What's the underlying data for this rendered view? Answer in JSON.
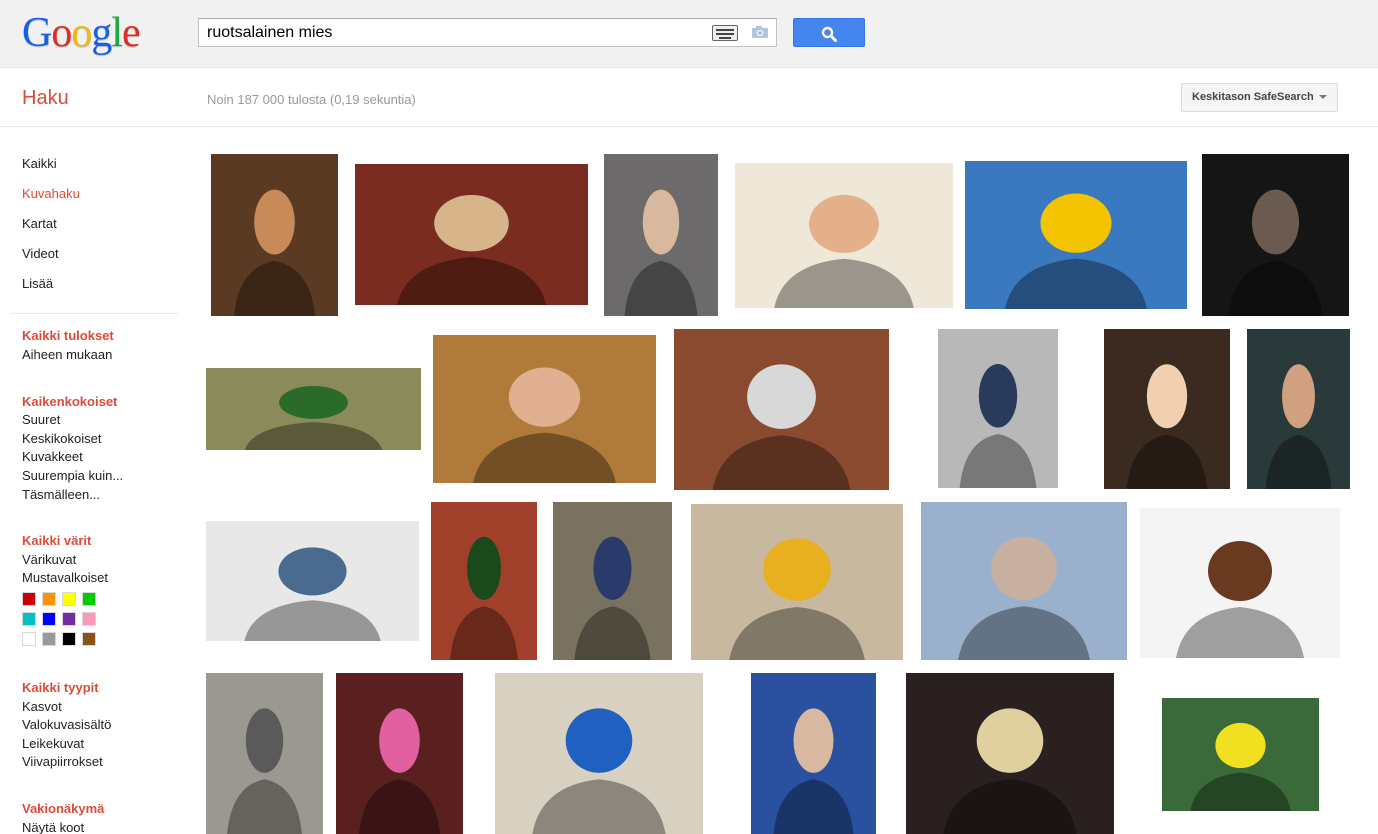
{
  "logo": {
    "letters": [
      "G",
      "o",
      "o",
      "g",
      "l",
      "e"
    ],
    "colors": [
      "#1a5ee8",
      "#dd2f23",
      "#f2b90a",
      "#1a5ee8",
      "#1ba83d",
      "#dd2f23"
    ]
  },
  "search": {
    "query": "ruotsalainen mies"
  },
  "subheader": {
    "title": "Haku",
    "stats": "Noin 187 000 tulosta (0,19 sekuntia)",
    "safesearch": "Keskitason SafeSearch"
  },
  "nav": {
    "primary": [
      "Kaikki",
      "Kuvahaku",
      "Kartat",
      "Videot",
      "Lisää"
    ],
    "results_head": "Kaikki tulokset",
    "results_items": [
      "Aiheen mukaan"
    ],
    "size_head": "Kaikenkokoiset",
    "size_items": [
      "Suuret",
      "Keskikokoiset",
      "Kuvakkeet",
      "Suurempia kuin...",
      "Täsmälleen..."
    ],
    "color_head": "Kaikki värit",
    "color_items": [
      "Värikuvat",
      "Mustavalkoiset"
    ],
    "color_swatches": [
      "#cc0000",
      "#fb940b",
      "#ffff00",
      "#00cc00",
      "#03c0c6",
      "#0000ff",
      "#762ca7",
      "#ff98bf",
      "#ffffff",
      "#999999",
      "#000000",
      "#885418"
    ],
    "type_head": "Kaikki tyypit",
    "type_items": [
      "Kasvot",
      "Valokuvasisältö",
      "Leikekuvat",
      "Viivapiirrokset"
    ],
    "view_head": "Vakionäkymä",
    "view_items": [
      "Näytä koot"
    ]
  },
  "images": [
    {
      "bg": "#5a3a22",
      "accent": "#c98a5a"
    },
    {
      "bg": "#7a2c20",
      "accent": "#d8b48a"
    },
    {
      "bg": "#6c6a6a",
      "accent": "#d9b8a0"
    },
    {
      "bg": "#efe7d8",
      "accent": "#e3b08a"
    },
    {
      "bg": "#3a78c0",
      "accent": "#f4c400"
    },
    {
      "bg": "#151515",
      "accent": "#6a5a50"
    },
    {
      "bg": "#8a8a5a",
      "accent": "#2a6a2a"
    },
    {
      "bg": "#b07a3a",
      "accent": "#e0b090"
    },
    {
      "bg": "#8a4a30",
      "accent": "#d8d8d8"
    },
    {
      "bg": "#b8b8b8",
      "accent": "#2a3a5a"
    },
    {
      "bg": "#3a2a20",
      "accent": "#f0d0b0"
    },
    {
      "bg": "#2a3a3a",
      "accent": "#d0a080"
    },
    {
      "bg": "#e8e8e8",
      "accent": "#4a6a90"
    },
    {
      "bg": "#a0402a",
      "accent": "#1a4a1a"
    },
    {
      "bg": "#7a7260",
      "accent": "#2a3a6a"
    },
    {
      "bg": "#c8b8a0",
      "accent": "#e8b020"
    },
    {
      "bg": "#9ab0cc",
      "accent": "#c8b0a0"
    },
    {
      "bg": "#f4f4f4",
      "accent": "#6a3a20"
    },
    {
      "bg": "#9a9890",
      "accent": "#5a5a5a"
    },
    {
      "bg": "#5a2020",
      "accent": "#e060a0"
    },
    {
      "bg": "#d8d0c0",
      "accent": "#2060c0"
    },
    {
      "bg": "#2a50a0",
      "accent": "#d8b8a0"
    },
    {
      "bg": "#2a2020",
      "accent": "#e0d0a0"
    },
    {
      "bg": "#3a6a3a",
      "accent": "#f0e020"
    }
  ]
}
